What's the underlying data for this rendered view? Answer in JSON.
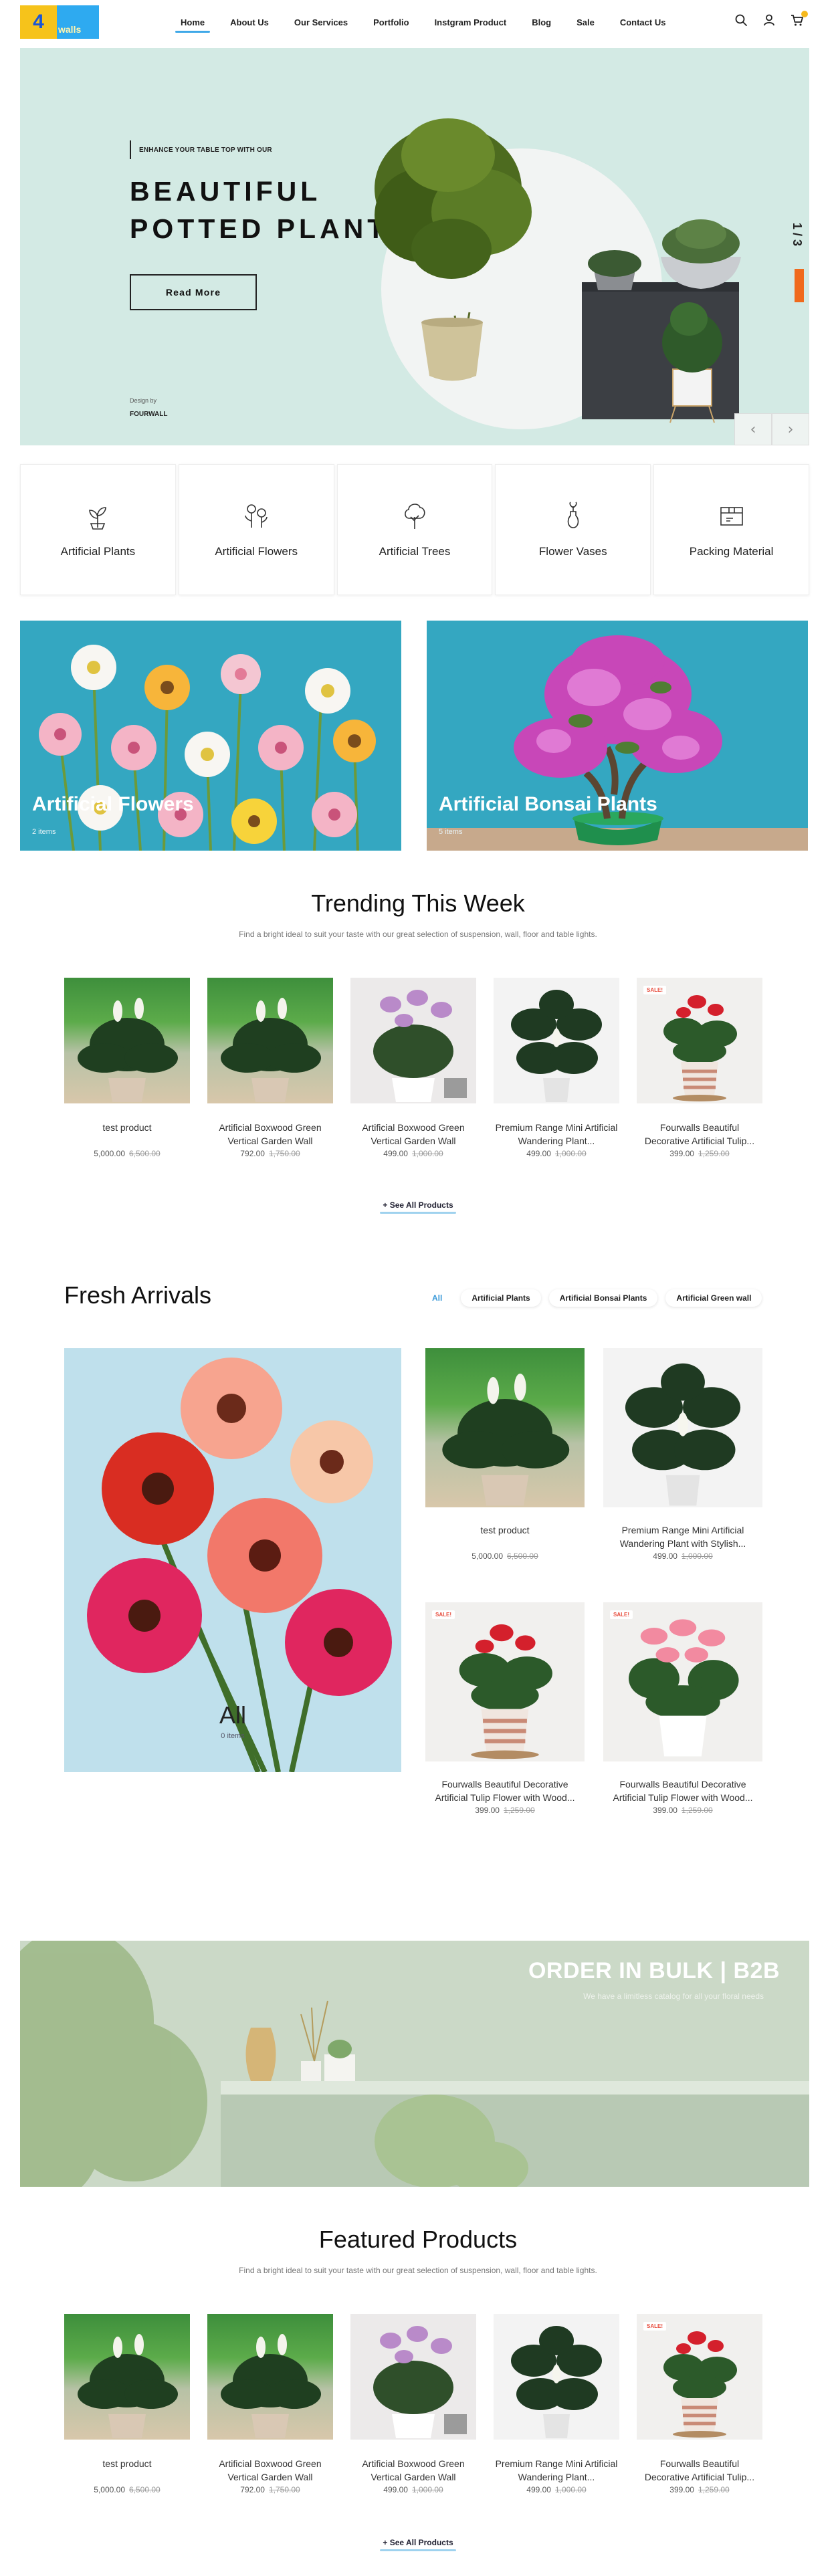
{
  "logo": {
    "mark": "4",
    "word": "walls"
  },
  "nav": {
    "items": [
      {
        "label": "Home"
      },
      {
        "label": "About Us"
      },
      {
        "label": "Our Services"
      },
      {
        "label": "Portfolio"
      },
      {
        "label": "Instgram Product"
      },
      {
        "label": "Blog"
      },
      {
        "label": "Sale"
      },
      {
        "label": "Contact Us"
      }
    ],
    "active_index": 0,
    "icons": [
      "search-icon",
      "user-icon",
      "cart-icon"
    ]
  },
  "hero": {
    "tagline": "ENHANCE YOUR TABLE TOP WITH OUR",
    "title_line1": "BEAUTIFUL",
    "title_line2": "POTTED PLANT",
    "button": "Read More",
    "design_by": "Design by",
    "brand": "FOURWALL",
    "counter": "1 / 3",
    "prev": "‹",
    "next": "›"
  },
  "categories": [
    {
      "label": "Artificial Plants",
      "icon": "plant-icon"
    },
    {
      "label": "Artificial Flowers",
      "icon": "flowers-icon"
    },
    {
      "label": "Artificial Trees",
      "icon": "tree-icon"
    },
    {
      "label": "Flower Vases",
      "icon": "vase-icon"
    },
    {
      "label": "Packing Material",
      "icon": "package-icon"
    }
  ],
  "banners": [
    {
      "title": "Artificial Flowers",
      "count": "2 items"
    },
    {
      "title": "Artificial Bonsai Plants",
      "count": "5 items"
    }
  ],
  "trending": {
    "title": "Trending This Week",
    "subtitle": "Find a bright ideal to suit your taste with our great selection of suspension, wall, floor and table lights.",
    "see_all": "+ See All Products",
    "products": [
      {
        "name": "test product",
        "price": "5,000.00",
        "old": "6,500.00",
        "sale": ""
      },
      {
        "name": "Artificial Boxwood Green Vertical Garden Wall",
        "price": "792.00",
        "old": "1,750.00",
        "sale": ""
      },
      {
        "name": "Artificial Boxwood Green Vertical Garden Wall",
        "price": "499.00",
        "old": "1,000.00",
        "sale": ""
      },
      {
        "name": "Premium Range Mini Artificial Wandering Plant...",
        "price": "499.00",
        "old": "1,000.00",
        "sale": ""
      },
      {
        "name": "Fourwalls Beautiful Decorative Artificial Tulip...",
        "price": "399.00",
        "old": "1,259.00",
        "sale": "SALE!"
      }
    ]
  },
  "fresh": {
    "title": "Fresh Arrivals",
    "tabs": [
      "All",
      "Artificial Plants",
      "Artificial Bonsai Plants",
      "Artificial Green wall"
    ],
    "big_title": "All",
    "big_count": "0 items",
    "products": [
      {
        "name": "test product",
        "price": "5,000.00",
        "old": "6,500.00",
        "sale": ""
      },
      {
        "name": "Premium Range Mini Artificial Wandering Plant with Stylish...",
        "price": "499.00",
        "old": "1,000.00",
        "sale": ""
      },
      {
        "name": "Fourwalls Beautiful Decorative Artificial Tulip Flower with Wood...",
        "price": "399.00",
        "old": "1,259.00",
        "sale": "SALE!"
      },
      {
        "name": "Fourwalls Beautiful Decorative Artificial Tulip Flower with Wood...",
        "price": "399.00",
        "old": "1,259.00",
        "sale": "SALE!"
      }
    ]
  },
  "b2b": {
    "title": "ORDER IN BULK | B2B",
    "subtitle": "We have a limitless catalog for all your floral needs"
  },
  "featured": {
    "title": "Featured Products",
    "subtitle": "Find a bright ideal to suit your taste with our great selection of suspension, wall, floor and table lights.",
    "see_all": "+ See All Products",
    "products": [
      {
        "name": "test product",
        "price": "5,000.00",
        "old": "6,500.00",
        "sale": ""
      },
      {
        "name": "Artificial Boxwood Green Vertical Garden Wall",
        "price": "792.00",
        "old": "1,750.00",
        "sale": ""
      },
      {
        "name": "Artificial Boxwood Green Vertical Garden Wall",
        "price": "499.00",
        "old": "1,000.00",
        "sale": ""
      },
      {
        "name": "Premium Range Mini Artificial Wandering Plant...",
        "price": "499.00",
        "old": "1,000.00",
        "sale": ""
      },
      {
        "name": "Fourwalls Beautiful Decorative Artificial Tulip...",
        "price": "399.00",
        "old": "1,259.00",
        "sale": "SALE!"
      }
    ]
  },
  "colors": {
    "accent": "#3fa8e8",
    "hero_bg": "#d3eae4",
    "banner_bg": "#34a7c1",
    "progress": "#f06a1c"
  }
}
